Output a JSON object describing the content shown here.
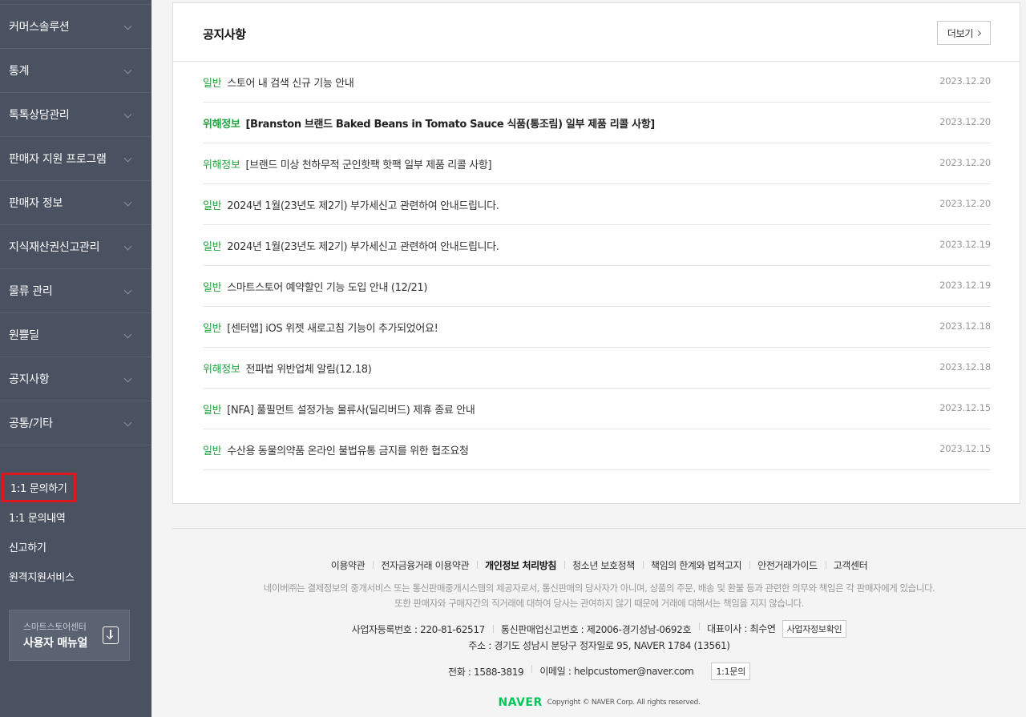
{
  "sidebar": {
    "nav_items": [
      {
        "label": "커머스솔루션"
      },
      {
        "label": "통계"
      },
      {
        "label": "톡톡상담관리"
      },
      {
        "label": "판매자 지원 프로그램"
      },
      {
        "label": "판매자 정보"
      },
      {
        "label": "지식재산권신고관리"
      },
      {
        "label": "물류 관리"
      },
      {
        "label": "원쁠딜"
      },
      {
        "label": "공지사항"
      },
      {
        "label": "공통/기타"
      }
    ],
    "util_items": [
      {
        "label": "1:1 문의하기"
      },
      {
        "label": "1:1 문의내역"
      },
      {
        "label": "신고하기"
      },
      {
        "label": "원격지원서비스"
      }
    ],
    "manual": {
      "subtitle": "스마트스토어센터",
      "title": "사용자 매뉴얼",
      "icon": "download-icon"
    }
  },
  "notice": {
    "title": "공지사항",
    "more_label": "더보기",
    "items": [
      {
        "category": "일반",
        "text": "스토어 내 검색 신규 기능 안내",
        "date": "2023.12.20",
        "bold": false
      },
      {
        "category": "위해정보",
        "text": "[Branston 브랜드 Baked Beans in Tomato Sauce 식품(통조림) 일부 제품 리콜 사항]",
        "date": "2023.12.20",
        "bold": true
      },
      {
        "category": "위해정보",
        "text": "[브랜드 미상 천하무적 군인핫팩 핫팩 일부 제품 리콜 사항]",
        "date": "2023.12.20",
        "bold": false
      },
      {
        "category": "일반",
        "text": "2024년 1월(23년도 제2기) 부가세신고 관련하여 안내드립니다.",
        "date": "2023.12.20",
        "bold": false
      },
      {
        "category": "일반",
        "text": "2024년 1월(23년도 제2기) 부가세신고 관련하여 안내드립니다.",
        "date": "2023.12.19",
        "bold": false
      },
      {
        "category": "일반",
        "text": "스마트스토어 예약할인 기능 도입 안내 (12/21)",
        "date": "2023.12.19",
        "bold": false
      },
      {
        "category": "일반",
        "text": "[센터앱] iOS 위젯 새로고침 기능이 추가되었어요!",
        "date": "2023.12.18",
        "bold": false
      },
      {
        "category": "위해정보",
        "text": "전파법 위반업체 알림(12.18)",
        "date": "2023.12.18",
        "bold": false
      },
      {
        "category": "일반",
        "text": "[NFA] 풀필먼트 설정가능 물류사(딜리버드) 제휴 종료 안내",
        "date": "2023.12.15",
        "bold": false
      },
      {
        "category": "일반",
        "text": "수산용 동물의약품 온라인 불법유통 금지를 위한 협조요청",
        "date": "2023.12.15",
        "bold": false
      }
    ]
  },
  "footer": {
    "links": [
      "이용약관",
      "전자금융거래 이용약관",
      "개인정보 처리방침",
      "청소년 보호정책",
      "책임의 한계와 법적고지",
      "안전거래가이드",
      "고객센터"
    ],
    "disclaimer_1": "네이버㈜는 결제정보의 중개서비스 또는 통신판매중개시스템의 제공자로서, 통신판매의 당사자가 아니며, 상품의 주문, 배송 및 환불 등과 관련한 의무와 책임은 각 판매자에게 있습니다.",
    "disclaimer_2": "또한 판매자와 구매자간의 직거래에 대하여 당사는 관여하지 않기 때문에 거래에 대해서는 책임을 지지 않습니다.",
    "biz_no": "사업자등록번호 : 220-81-62517",
    "mail_order_no": "통신판매업신고번호 : 제2006-경기성남-0692호",
    "ceo": "대표이사 : 최수연",
    "biz_info_button": "사업자정보확인",
    "address": "주소 : 경기도 성남시 분당구 정자일로 95, NAVER 1784 (13561)",
    "phone": "전화 : 1588-3819",
    "email": "이메일 : helpcustomer@naver.com",
    "inquiry_button": "1:1문의",
    "logo": "NAVER",
    "copyright": "Copyright © NAVER Corp. All rights reserved."
  }
}
